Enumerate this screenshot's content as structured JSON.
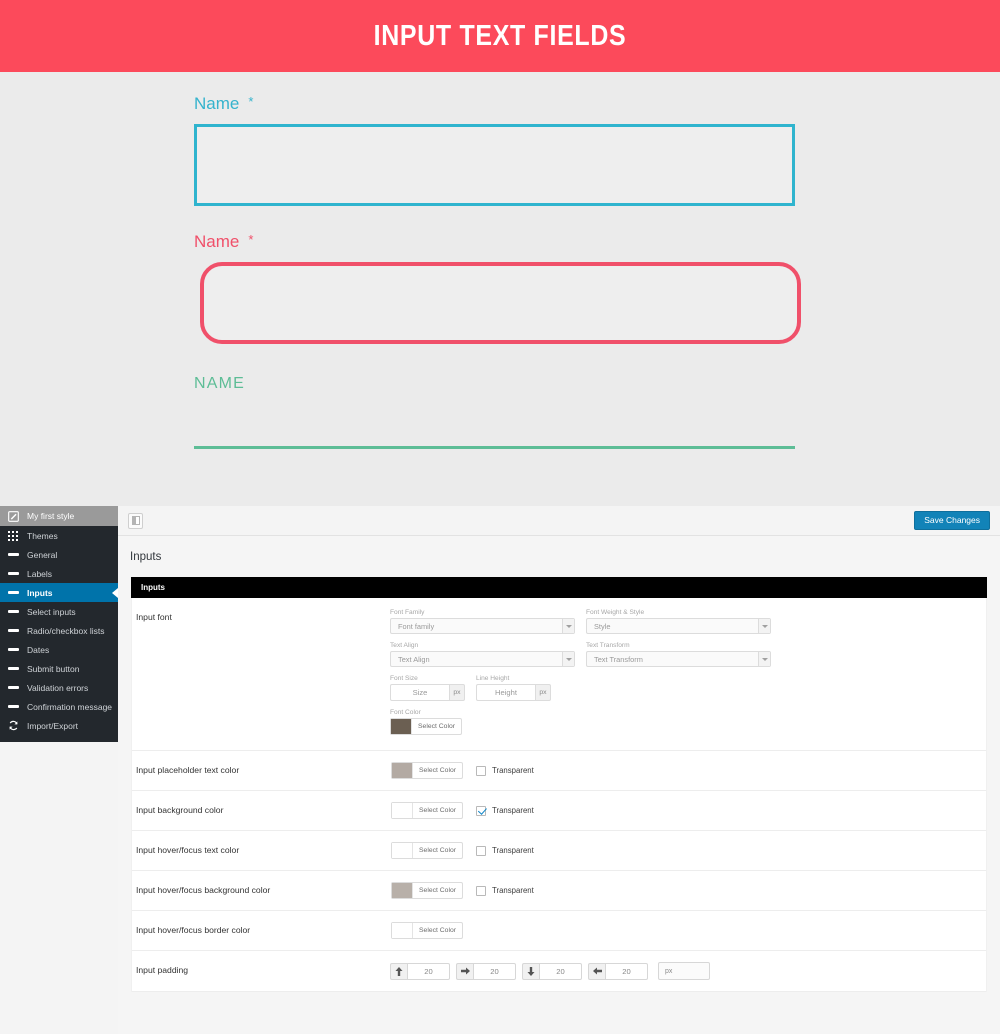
{
  "banner": {
    "title": "INPUT TEXT FIELDS"
  },
  "preview": {
    "fields": [
      {
        "label": "Name",
        "required_mark": "*",
        "placeholder": "",
        "style": "cyan-square"
      },
      {
        "label": "Name",
        "required_mark": "*",
        "placeholder": "",
        "style": "red-rounded"
      },
      {
        "label": "NAME",
        "required_mark": "",
        "placeholder": "",
        "style": "green-underline"
      }
    ],
    "colors": {
      "cyan": "#2fb4ce",
      "red": "#f0506a",
      "green": "#5dbd96",
      "page_bg": "#ebebeb",
      "panel_bg": "#eeeeee"
    }
  },
  "sidebar": {
    "header": {
      "label": "My first style",
      "icon": "pencil-square-icon"
    },
    "items": [
      {
        "label": "Themes",
        "icon": "grid-icon",
        "active": false
      },
      {
        "label": "General",
        "icon": "dash-icon",
        "active": false
      },
      {
        "label": "Labels",
        "icon": "dash-icon",
        "active": false
      },
      {
        "label": "Inputs",
        "icon": "dash-icon",
        "active": true
      },
      {
        "label": "Select inputs",
        "icon": "dash-icon",
        "active": false
      },
      {
        "label": "Radio/checkbox lists",
        "icon": "dash-icon",
        "active": false
      },
      {
        "label": "Dates",
        "icon": "dash-icon",
        "active": false
      },
      {
        "label": "Submit button",
        "icon": "dash-icon",
        "active": false
      },
      {
        "label": "Validation errors",
        "icon": "dash-icon",
        "active": false
      },
      {
        "label": "Confirmation message",
        "icon": "dash-icon",
        "active": false
      },
      {
        "label": "Import/Export",
        "icon": "sync-icon",
        "active": false
      }
    ],
    "active_color": "#0073aa",
    "bg_color": "#23282d"
  },
  "topbar": {
    "toggle_icon": "panel-toggle-icon",
    "save_label": "Save Changes",
    "save_color": "#1283b8"
  },
  "page": {
    "title": "Inputs",
    "tab_label": "Inputs"
  },
  "settings": {
    "font_row": {
      "label": "Input font",
      "font_family": {
        "label": "Font Family",
        "value": "Font family"
      },
      "font_weight": {
        "label": "Font Weight & Style",
        "value": "Style"
      },
      "text_align": {
        "label": "Text Align",
        "value": "Text Align"
      },
      "text_transform": {
        "label": "Text Transform",
        "value": "Text Transform"
      },
      "font_size": {
        "label": "Font Size",
        "value": "Size",
        "unit": "px"
      },
      "line_height": {
        "label": "Line Height",
        "value": "Height",
        "unit": "px"
      },
      "font_color": {
        "label": "Font Color",
        "button": "Select Color",
        "swatch": "#6b5f52"
      }
    },
    "color_rows": [
      {
        "label": "Input placeholder text color",
        "button": "Select Color",
        "swatch": "#b3aaa3",
        "transparent_label": "Transparent",
        "transparent_checked": false
      },
      {
        "label": "Input background color",
        "button": "Select Color",
        "swatch": "#ffffff",
        "transparent_label": "Transparent",
        "transparent_checked": true
      },
      {
        "label": "Input hover/focus text color",
        "button": "Select Color",
        "swatch": "#ffffff",
        "transparent_label": "Transparent",
        "transparent_checked": false
      },
      {
        "label": "Input hover/focus background color",
        "button": "Select Color",
        "swatch": "#b8b0a9",
        "transparent_label": "Transparent",
        "transparent_checked": false
      },
      {
        "label": "Input hover/focus border color",
        "button": "Select Color",
        "swatch": "#ffffff",
        "transparent_label": "",
        "transparent_checked": null
      }
    ],
    "padding_row": {
      "label": "Input padding",
      "top": "20",
      "right": "20",
      "bottom": "20",
      "left": "20",
      "unit": "px"
    }
  }
}
